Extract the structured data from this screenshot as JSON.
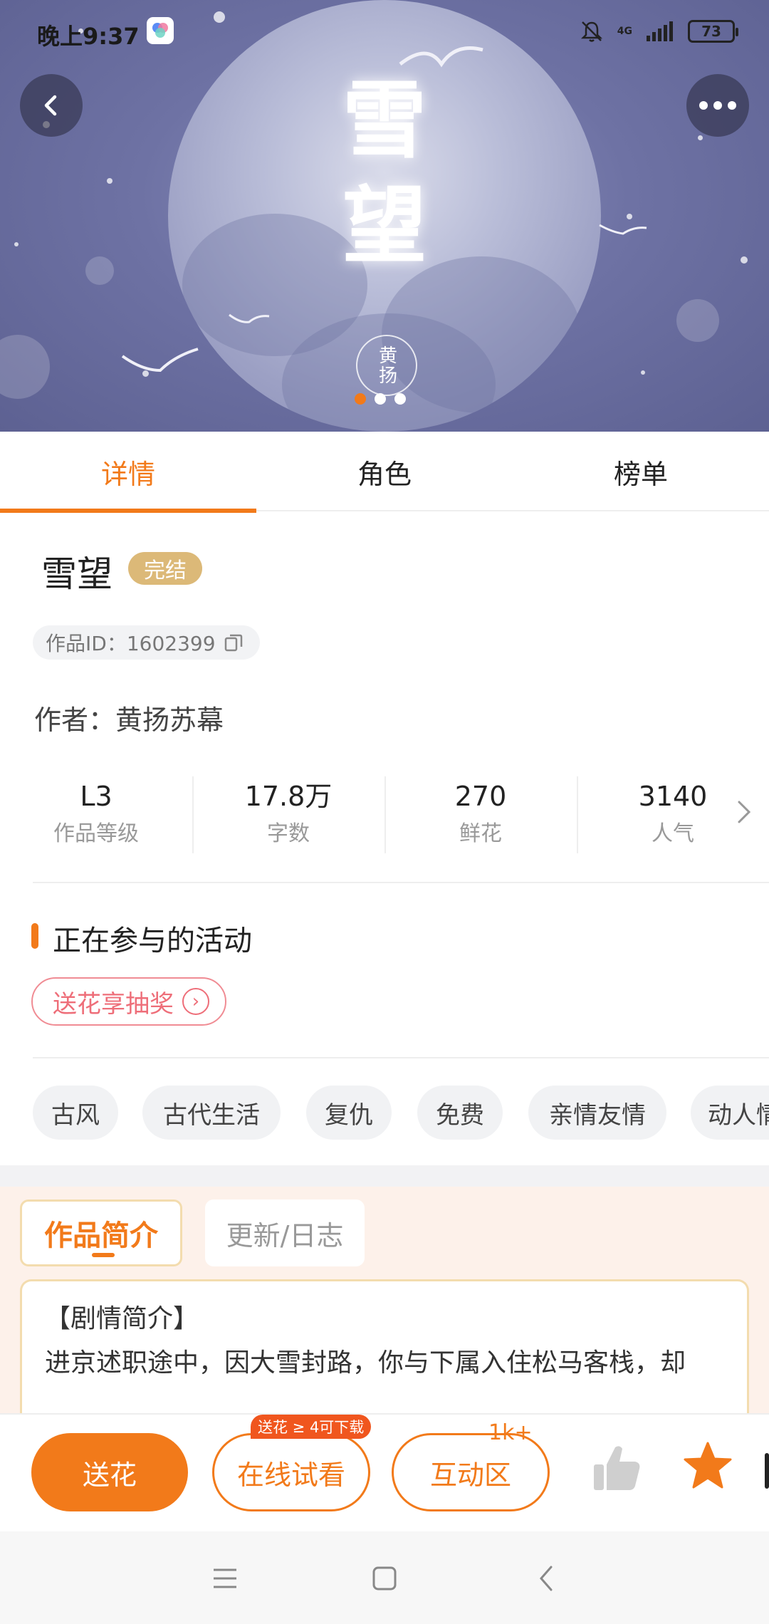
{
  "status_bar": {
    "time": "晚上9:37",
    "network": "4G",
    "battery": "73"
  },
  "hero": {
    "poster_title": "雪望",
    "poster_seal": "黄扬",
    "carousel_count": 3,
    "carousel_active_index": 0,
    "icons": {
      "back": "back-icon",
      "more": "more-icon"
    }
  },
  "tabs": [
    {
      "label": "详情",
      "active": true
    },
    {
      "label": "角色",
      "active": false
    },
    {
      "label": "榜单",
      "active": false
    }
  ],
  "work": {
    "title": "雪望",
    "status_badge": "完结",
    "id_text": "作品ID：1602399",
    "author_text": "作者：黄扬苏幕"
  },
  "stats": [
    {
      "value": "L3",
      "label": "作品等级"
    },
    {
      "value": "17.8万",
      "label": "字数"
    },
    {
      "value": "270",
      "label": "鲜花"
    },
    {
      "value": "3140",
      "label": "人气"
    }
  ],
  "activities": {
    "title": "正在参与的活动",
    "items": [
      "送花享抽奖"
    ]
  },
  "tags": [
    "古风",
    "古代生活",
    "复仇",
    "免费",
    "亲情友情",
    "动人情"
  ],
  "intro": {
    "tabs": [
      {
        "label": "作品简介",
        "active": true
      },
      {
        "label": "更新/日志",
        "active": false
      }
    ],
    "heading": "【剧情简介】",
    "text": "进京述职途中，因大雪封路，你与下属入住松马客栈，却"
  },
  "action_bar": {
    "send_flower": "送花",
    "trial": "在线试看",
    "trial_badge": "送花 ≥ 4可下载",
    "interact": "互动区",
    "interact_count": "1k+"
  },
  "colors": {
    "accent": "#f27a1a",
    "badge_gold": "#dcb978",
    "activity_pink": "#ee6e79"
  }
}
